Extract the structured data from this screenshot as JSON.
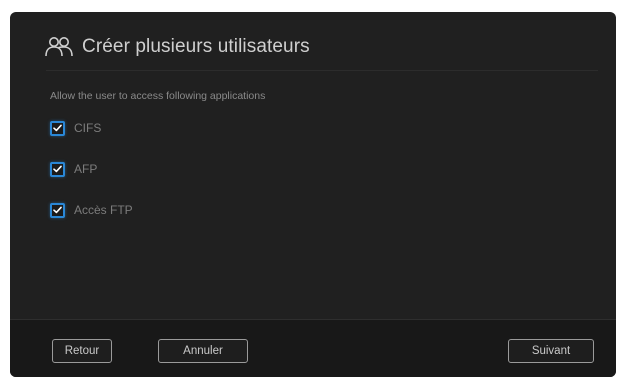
{
  "dialog": {
    "title": "Créer plusieurs utilisateurs",
    "title_icon": "users-icon",
    "instruction": "Allow the user to access following applications",
    "applications": [
      {
        "label": "CIFS",
        "checked": true
      },
      {
        "label": "AFP",
        "checked": true
      },
      {
        "label": "Accès FTP",
        "checked": true
      }
    ]
  },
  "footer": {
    "back_label": "Retour",
    "cancel_label": "Annuler",
    "next_label": "Suivant"
  },
  "colors": {
    "background": "#202020",
    "footer_background": "#181818",
    "checkbox_accent": "#2a87d6",
    "title_text": "#cfcfcf"
  }
}
